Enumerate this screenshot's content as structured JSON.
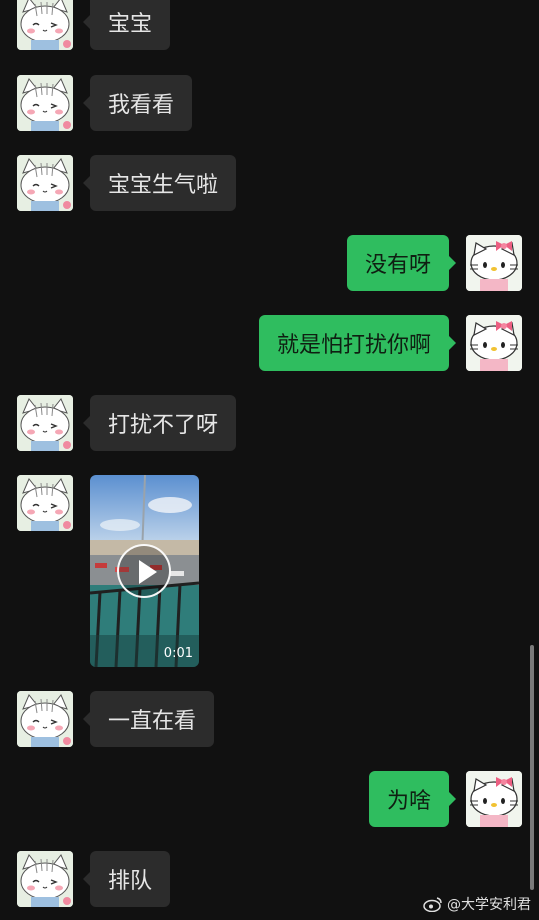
{
  "messages": [
    {
      "id": "m1",
      "side": "in",
      "text": "宝宝"
    },
    {
      "id": "m2",
      "side": "in",
      "text": "我看看"
    },
    {
      "id": "m3",
      "side": "in",
      "text": "宝宝生气啦"
    },
    {
      "id": "m4",
      "side": "out",
      "text": "没有呀"
    },
    {
      "id": "m5",
      "side": "out",
      "text": "就是怕打扰你啊"
    },
    {
      "id": "m6",
      "side": "in",
      "text": "打扰不了呀"
    },
    {
      "id": "m7",
      "side": "in",
      "type": "video",
      "duration": "0:01"
    },
    {
      "id": "m8",
      "side": "in",
      "text": "一直在看"
    },
    {
      "id": "m9",
      "side": "out",
      "text": "为啥"
    },
    {
      "id": "m10",
      "side": "in",
      "text": "排队"
    }
  ],
  "icons": {
    "contact_avatar": "cat-avatar-icon",
    "self_avatar": "hello-kitty-avatar-icon",
    "play": "play-icon",
    "watermark_logo": "weibo-icon"
  },
  "colors": {
    "background": "#111111",
    "incoming_bubble": "#2c2c2c",
    "outgoing_bubble": "#2fbd5f"
  },
  "watermark": {
    "text": "@大学安利君"
  }
}
